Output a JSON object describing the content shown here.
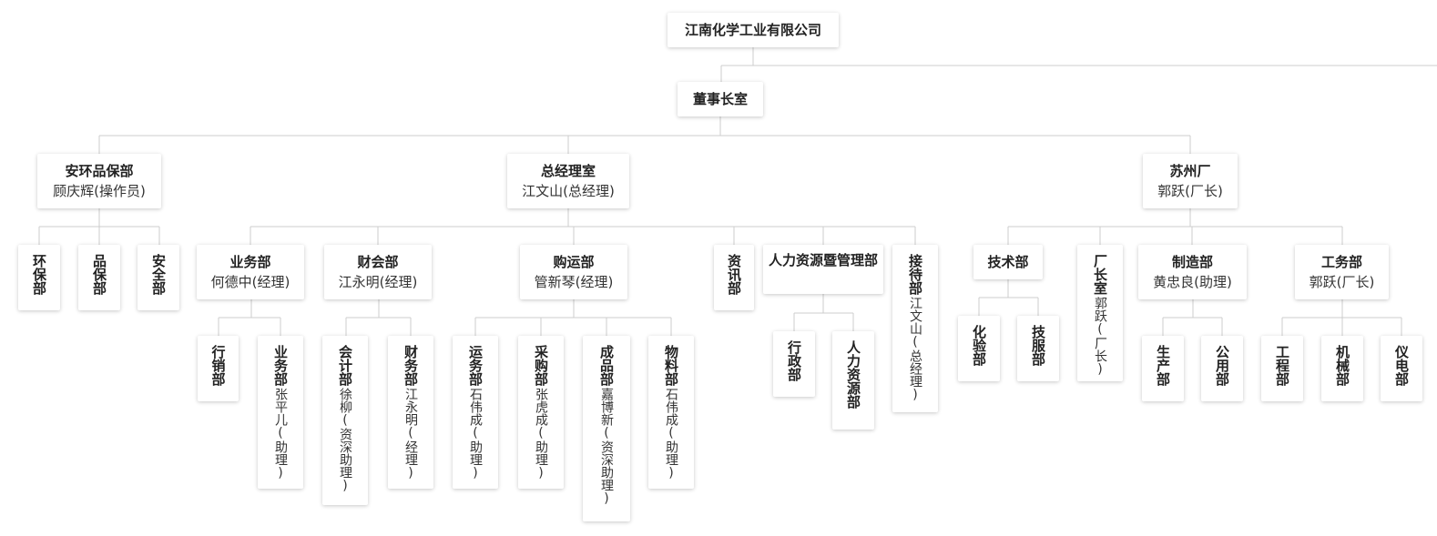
{
  "line_color": "#cccccc",
  "nodes": [
    {
      "id": "n1",
      "title": "江南化学工业有限公司",
      "sub": ""
    },
    {
      "id": "n2",
      "title": "董事长室",
      "sub": ""
    },
    {
      "id": "n3",
      "title": "安环品保部",
      "sub": "顾庆辉(操作员)"
    },
    {
      "id": "n4",
      "title": "总经理室",
      "sub": "江文山(总经理)"
    },
    {
      "id": "n5",
      "title": "苏州厂",
      "sub": "郭跃(厂长)"
    },
    {
      "id": "n6",
      "title": "环保部",
      "sub": ""
    },
    {
      "id": "n7",
      "title": "品保部",
      "sub": ""
    },
    {
      "id": "n8",
      "title": "安全部",
      "sub": ""
    },
    {
      "id": "n9",
      "title": "业务部",
      "sub": "何德中(经理)"
    },
    {
      "id": "n10",
      "title": "财会部",
      "sub": "江永明(经理)"
    },
    {
      "id": "n11",
      "title": "购运部",
      "sub": "管新琴(经理)"
    },
    {
      "id": "n12",
      "title": "资讯部",
      "sub": ""
    },
    {
      "id": "n13",
      "title": "人力资源暨管理部",
      "sub": ""
    },
    {
      "id": "n14",
      "title": "接待部",
      "sub": "江文山(总经理)"
    },
    {
      "id": "n15",
      "title": "技术部",
      "sub": ""
    },
    {
      "id": "n16",
      "title": "厂长室",
      "sub": "郭跃(厂长)"
    },
    {
      "id": "n17",
      "title": "制造部",
      "sub": "黄忠良(助理)"
    },
    {
      "id": "n18",
      "title": "工务部",
      "sub": "郭跃(厂长)"
    },
    {
      "id": "n19",
      "title": "行销部",
      "sub": ""
    },
    {
      "id": "n20",
      "title": "业务部",
      "sub": "张平儿(助理)"
    },
    {
      "id": "n21",
      "title": "会计部",
      "sub": "徐柳(资深助理)"
    },
    {
      "id": "n22",
      "title": "财务部",
      "sub": "江永明(经理)"
    },
    {
      "id": "n23",
      "title": "运务部",
      "sub": "石伟成(助理)"
    },
    {
      "id": "n24",
      "title": "采购部",
      "sub": "张虎成(助理)"
    },
    {
      "id": "n25",
      "title": "成品部",
      "sub": "嘉博新(资深助理)"
    },
    {
      "id": "n26",
      "title": "物料部",
      "sub": "石伟成(助理)"
    },
    {
      "id": "n27",
      "title": "行政部",
      "sub": ""
    },
    {
      "id": "n28",
      "title": "人力资源部",
      "sub": ""
    },
    {
      "id": "n29",
      "title": "化验部",
      "sub": ""
    },
    {
      "id": "n30",
      "title": "技服部",
      "sub": ""
    },
    {
      "id": "n31",
      "title": "生产部",
      "sub": ""
    },
    {
      "id": "n32",
      "title": "公用部",
      "sub": ""
    },
    {
      "id": "n33",
      "title": "工程部",
      "sub": ""
    },
    {
      "id": "n34",
      "title": "机械部",
      "sub": ""
    },
    {
      "id": "n35",
      "title": "仪电部",
      "sub": ""
    }
  ]
}
